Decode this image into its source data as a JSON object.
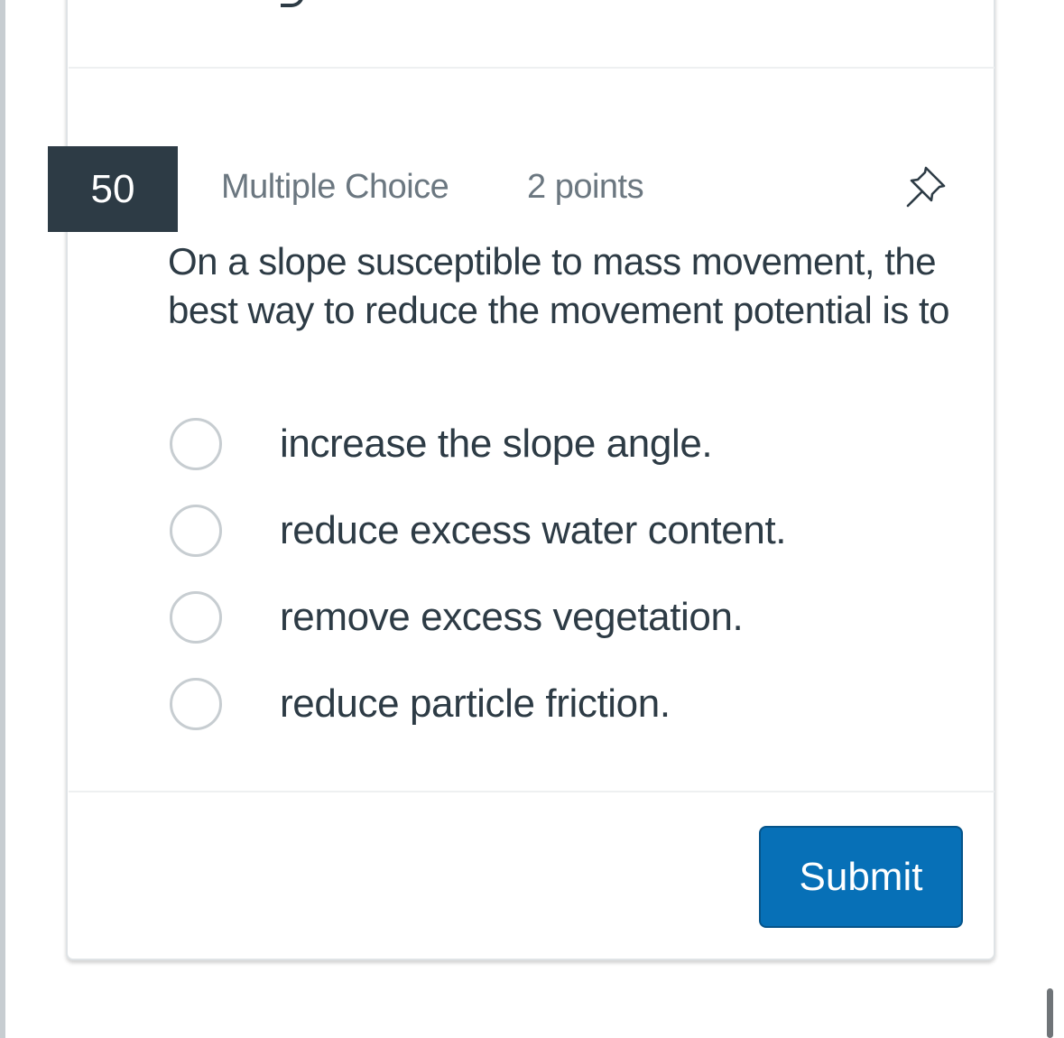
{
  "question": {
    "number": "50",
    "type": "Multiple Choice",
    "points": "2 points",
    "text": "On a slope susceptible to mass movement, the best way to reduce the movement potential is to",
    "pin_icon": "pin-icon"
  },
  "answers": [
    {
      "label": "increase the slope angle.",
      "selected": false
    },
    {
      "label": "reduce excess water content.",
      "selected": false
    },
    {
      "label": "remove excess vegetation.",
      "selected": false
    },
    {
      "label": "reduce particle friction.",
      "selected": false
    }
  ],
  "submit": {
    "label": "Submit"
  },
  "colors": {
    "accent": "#0770b7",
    "number_badge": "#2d3b45",
    "text": "#2d3b45",
    "muted": "#6b7780"
  }
}
